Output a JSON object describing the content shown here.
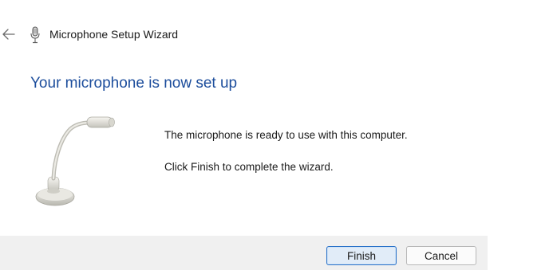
{
  "window": {
    "title": "Microphone Setup Wizard",
    "back_icon": "back-arrow-icon",
    "app_icon": "microphone-icon"
  },
  "content": {
    "heading": "Your microphone is now set up",
    "message_ready": "The microphone is ready to use with this computer.",
    "message_finish": "Click Finish to complete the wizard.",
    "illustration": "desk-microphone-illustration"
  },
  "footer": {
    "finish_label": "Finish",
    "cancel_label": "Cancel"
  },
  "colors": {
    "heading": "#1c4d9c",
    "footer_bg": "#f0f0f0",
    "primary_border": "#2a72c9"
  }
}
